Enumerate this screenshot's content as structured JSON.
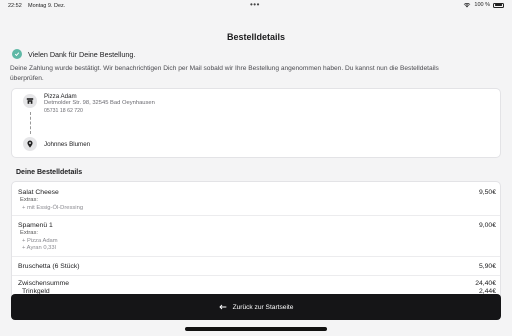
{
  "status_bar": {
    "time": "22:52",
    "date": "Montag 9. Dez.",
    "battery": "100 %",
    "dots": "•••"
  },
  "header": {
    "title": "Bestelldetails"
  },
  "confirmation": {
    "thanks": "Vielen Dank für Deine Bestellung.",
    "description": "Deine Zahlung wurde bestätigt. Wir benachrichtigen Dich per Mail sobald wir Ihre Bestellung angenommen haben. Du kannst nun die Bestelldetails überprüfen."
  },
  "route": {
    "restaurant_name": "Pizza Adam",
    "restaurant_address": "Detmolder Str. 98, 32545 Bad Oeynhausen",
    "restaurant_phone": "05731 18 62 720",
    "customer_name": "Johnnes Blumen"
  },
  "order": {
    "heading": "Deine Bestelldetails",
    "items": [
      {
        "name": "Salat Cheese",
        "price": "9,50€",
        "extras_label": "Extras:",
        "extras": [
          "+ mit Essig-Öl-Dressing"
        ]
      },
      {
        "name": "Spamenü 1",
        "price": "9,00€",
        "extras_label": "Extras:",
        "extras": [
          "+ Pizza Adam",
          "+ Ayran 0,33l"
        ]
      },
      {
        "name": "Bruschetta (6 Stück)",
        "price": "5,90€"
      }
    ],
    "subtotal_label": "Zwischensumme",
    "subtotal_value": "24,40€",
    "tip_label": "Trinkgeld",
    "tip_value": "2,44€"
  },
  "footer": {
    "back_button": "Zurück zur Startseite"
  },
  "colors": {
    "accent_check": "#5fb8a6",
    "button_bg": "#151517"
  }
}
